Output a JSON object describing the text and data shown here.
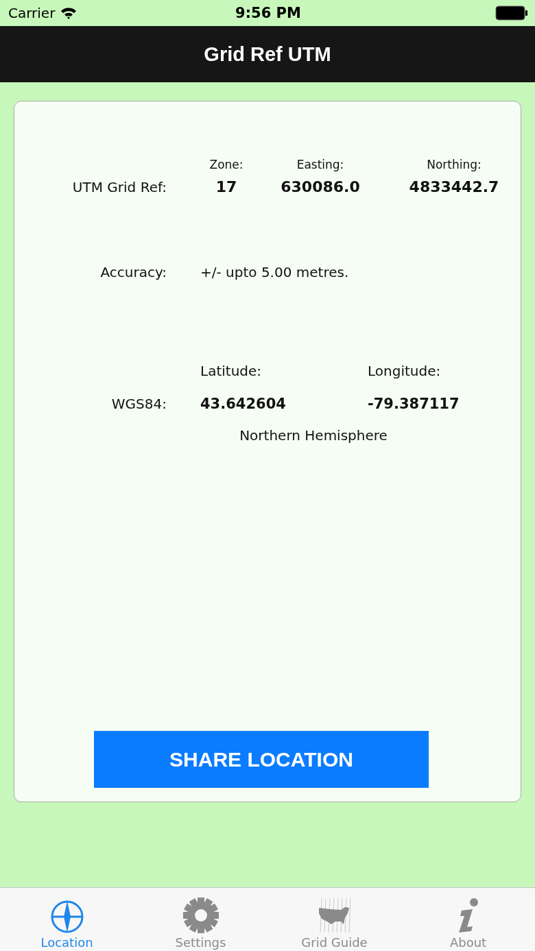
{
  "status_bar": {
    "carrier": "Carrier",
    "time": "9:56 PM"
  },
  "nav_bar": {
    "title": "Grid Ref UTM"
  },
  "utm": {
    "label": "UTM Grid Ref:",
    "columns": [
      {
        "header": "Zone:",
        "value": "17"
      },
      {
        "header": "Easting:",
        "value": "630086.0"
      },
      {
        "header": "Northing:",
        "value": "4833442.7"
      }
    ]
  },
  "accuracy": {
    "label": "Accuracy:",
    "value": "+/- upto 5.00 metres."
  },
  "wgs84": {
    "label": "WGS84:",
    "columns": [
      {
        "header": "Latitude:",
        "value": "43.642604"
      },
      {
        "header": "Longitude:",
        "value": "-79.387117"
      }
    ],
    "hemisphere": "Northern Hemisphere"
  },
  "share_button": {
    "label": "SHARE LOCATION"
  },
  "tabs": [
    {
      "label": "Location",
      "selected": true
    },
    {
      "label": "Settings",
      "selected": false
    },
    {
      "label": "Grid Guide",
      "selected": false
    },
    {
      "label": "About",
      "selected": false
    }
  ]
}
